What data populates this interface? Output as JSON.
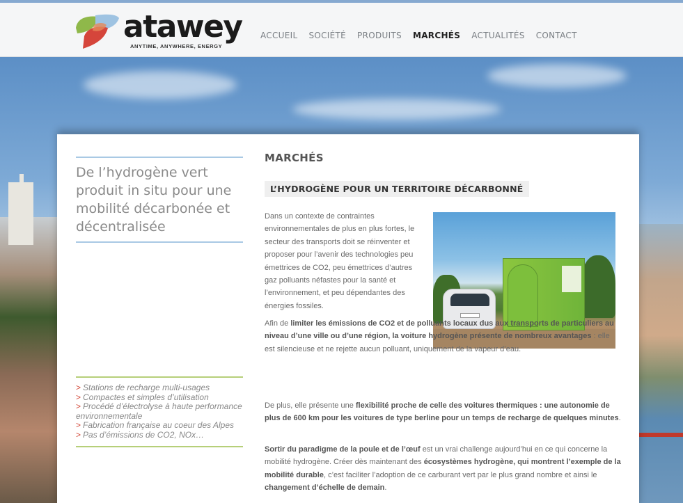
{
  "header": {
    "logo_text": "atawey",
    "logo_tagline": "ANYTIME, ANYWHERE, ENERGY",
    "nav": [
      {
        "label": "ACCUEIL",
        "active": false
      },
      {
        "label": "SOCIÉTÉ",
        "active": false
      },
      {
        "label": "PRODUITS",
        "active": false
      },
      {
        "label": "MARCHÉS",
        "active": true
      },
      {
        "label": "ACTUALITÉS",
        "active": false
      },
      {
        "label": "CONTACT",
        "active": false
      }
    ]
  },
  "sidebar": {
    "tagline": "De l’hydrogène vert produit in situ pour une mobilité décarbonée et décentralisée",
    "features": [
      "Stations de recharge multi-usages",
      "Compactes et simples d’utilisation",
      "Procédé d’électrolyse à haute performance environnementale",
      "Fabrication française au coeur des Alpes",
      "Pas d’émissions de CO2, NOx…"
    ]
  },
  "main": {
    "page_title": "MARCHÉS",
    "section_title": "L’HYDROGÈNE POUR UN TERRITOIRE DÉCARBONNÉ",
    "p1": "Dans un contexte de contraintes environnementales de plus en plus fortes, le secteur des transports doit se réinventer et proposer pour l’avenir des technologies peu émettrices de CO2, peu émettrices d’autres gaz polluants néfastes pour la santé et l’environnement, et peu dépendantes des énergies fossiles.",
    "p2_a": "Afin de ",
    "p2_b": "limiter les émissions de CO2 et de polluants locaux dus aux transports de particuliers au niveau d’une ville ou d’une région, la voiture hydrogène présente de nombreux avantages",
    "p2_c": " : elle est silencieuse et ne rejette aucun polluant, uniquement de la vapeur d’eau.",
    "p3_a": "De plus, elle présente une ",
    "p3_b": "flexibilité proche de celle des voitures thermiques : une autonomie de plus de 600 km pour les voitures de type berline pour un temps de recharge de quelques minutes",
    "p3_c": ".",
    "p4_a": "Sortir du paradigme de la poule et de l’œuf",
    "p4_b": " est un vrai challenge aujourd’hui en ce qui concerne la mobilité hydrogène. Créer dès maintenant des ",
    "p4_c": "écosystèmes hydrogène, qui montrent l’exemple de la mobilité durable",
    "p4_d": ", c’est faciliter l’adoption de ce carburant vert par le plus grand nombre et ainsi le ",
    "p4_e": "changement d’échelle de demain",
    "p4_f": "."
  },
  "colors": {
    "accent_blue": "#a9c9e4",
    "accent_green": "#b6cf79",
    "arrow_red": "#d34a3a"
  }
}
